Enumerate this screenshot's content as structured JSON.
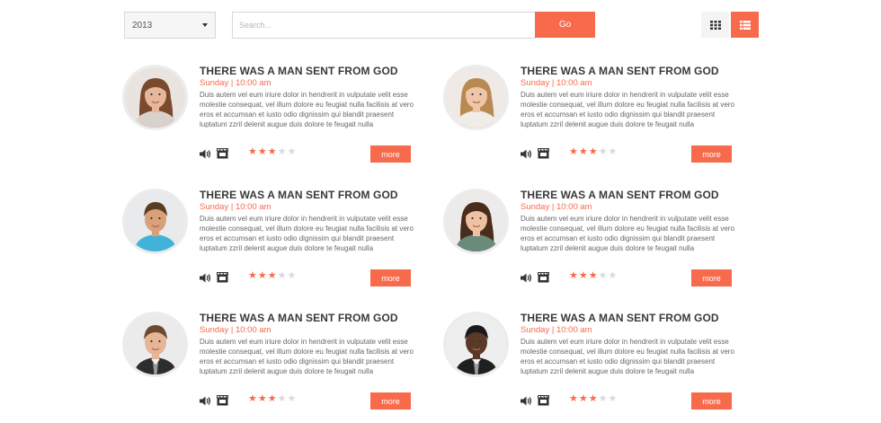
{
  "toolbar": {
    "year_value": "2013",
    "search_placeholder": "Search...",
    "go_label": "Go",
    "active_view": "list"
  },
  "colors": {
    "accent": "#f86a4c",
    "title": "#3a3a3a",
    "star_off": "#d9d9d9"
  },
  "cards": [
    {
      "title": "THERE WAS A MAN SENT FROM GOD",
      "meta": "Sunday | 10:00 am",
      "description": "Duis autem vel eum iriure dolor in hendrerit in vulputate velit esse molestie consequat, vel illum dolore eu feugiat nulla facilisis at vero eros et accumsan et iusto odio dignissim qui blandit praesent luptatum zzril delenit augue duis dolore te feugait nulla",
      "rating": 3,
      "rating_max": 5,
      "more_label": "more"
    },
    {
      "title": "THERE WAS A MAN SENT FROM GOD",
      "meta": "Sunday | 10:00 am",
      "description": "Duis autem vel eum iriure dolor in hendrerit in vulputate velit esse molestie consequat, vel illum dolore eu feugiat nulla facilisis at vero eros et accumsan et iusto odio dignissim qui blandit praesent luptatum zzril delenit augue duis dolore te feugait nulla",
      "rating": 3,
      "rating_max": 5,
      "more_label": "more"
    },
    {
      "title": "THERE WAS A MAN SENT FROM GOD",
      "meta": "Sunday | 10:00 am",
      "description": "Duis autem vel eum iriure dolor in hendrerit in vulputate velit esse molestie consequat, vel illum dolore eu feugiat nulla facilisis at vero eros et accumsan et iusto odio dignissim qui blandit praesent luptatum zzril delenit augue duis dolore te feugait nulla",
      "rating": 3,
      "rating_max": 5,
      "more_label": "more"
    },
    {
      "title": "THERE WAS A MAN SENT FROM GOD",
      "meta": "Sunday | 10:00 am",
      "description": "Duis autem vel eum iriure dolor in hendrerit in vulputate velit esse molestie consequat, vel illum dolore eu feugiat nulla facilisis at vero eros et accumsan et iusto odio dignissim qui blandit praesent luptatum zzril delenit augue duis dolore te feugait nulla",
      "rating": 3,
      "rating_max": 5,
      "more_label": "more"
    },
    {
      "title": "THERE WAS A MAN SENT FROM GOD",
      "meta": "Sunday | 10:00 am",
      "description": "Duis autem vel eum iriure dolor in hendrerit in vulputate velit esse molestie consequat, vel illum dolore eu feugiat nulla facilisis at vero eros et accumsan et iusto odio dignissim qui blandit praesent luptatum zzril delenit augue duis dolore te feugait nulla",
      "rating": 3,
      "rating_max": 5,
      "more_label": "more"
    },
    {
      "title": "THERE WAS A MAN SENT FROM GOD",
      "meta": "Sunday | 10:00 am",
      "description": "Duis autem vel eum iriure dolor in hendrerit in vulputate velit esse molestie consequat, vel illum dolore eu feugiat nulla facilisis at vero eros et accumsan et iusto odio dignissim qui blandit praesent luptatum zzril delenit augue duis dolore te feugait nulla",
      "rating": 3,
      "rating_max": 5,
      "more_label": "more"
    }
  ]
}
